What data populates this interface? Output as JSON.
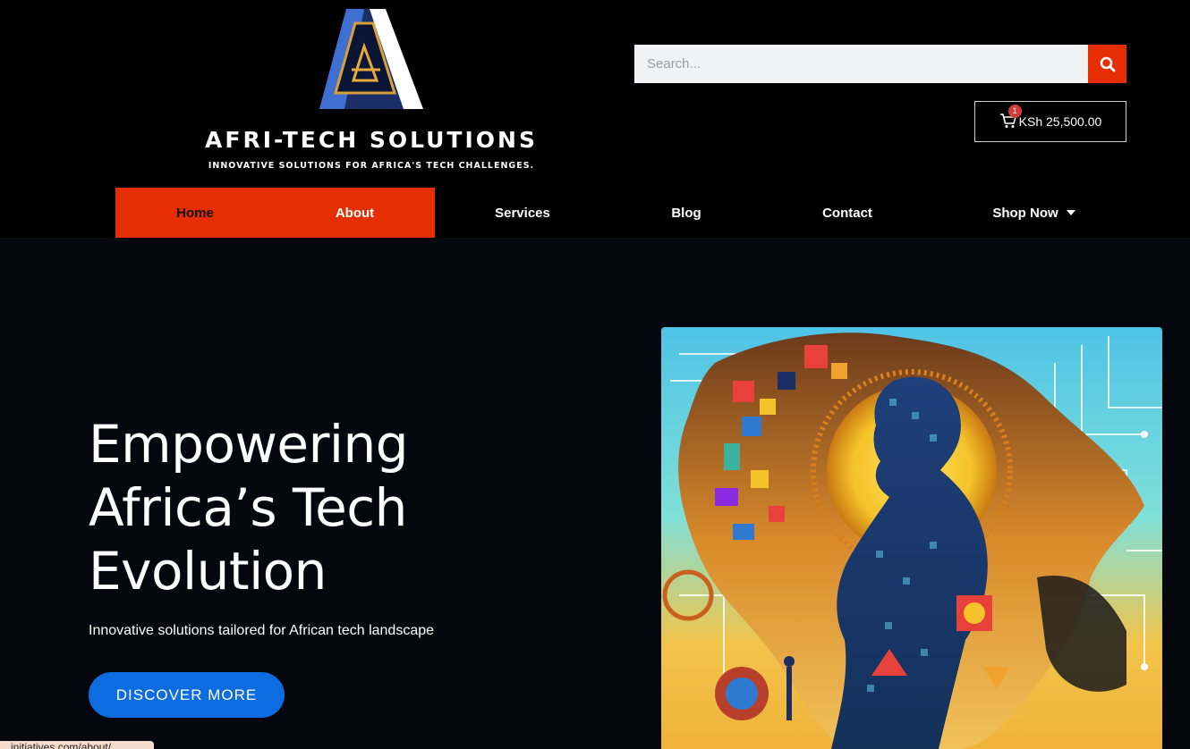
{
  "brand": {
    "title": "AFRI-TECH SOLUTIONS",
    "tagline": "INNOVATIVE SOLUTIONS FOR AFRICA'S TECH CHALLENGES.",
    "logo_letter": "A"
  },
  "search": {
    "placeholder": "Search..."
  },
  "cart": {
    "count": "1",
    "total": "KSh 25,500.00"
  },
  "nav": {
    "home": "Home",
    "about": "About",
    "services": "Services",
    "blog": "Blog",
    "contact": "Contact",
    "shop": "Shop Now"
  },
  "hero": {
    "title_line1": "Empowering",
    "title_line2": "Africa’s Tech",
    "title_line3": "Evolution",
    "subtitle": "Innovative solutions tailored for African tech landscape",
    "cta": "DISCOVER MORE"
  },
  "status_bar": {
    "url": "...initiatives.com/about/"
  },
  "colors": {
    "accent": "#e62e04",
    "cta": "#0d6de0",
    "header_bg": "#000000",
    "hero_bg": "#06060f"
  }
}
